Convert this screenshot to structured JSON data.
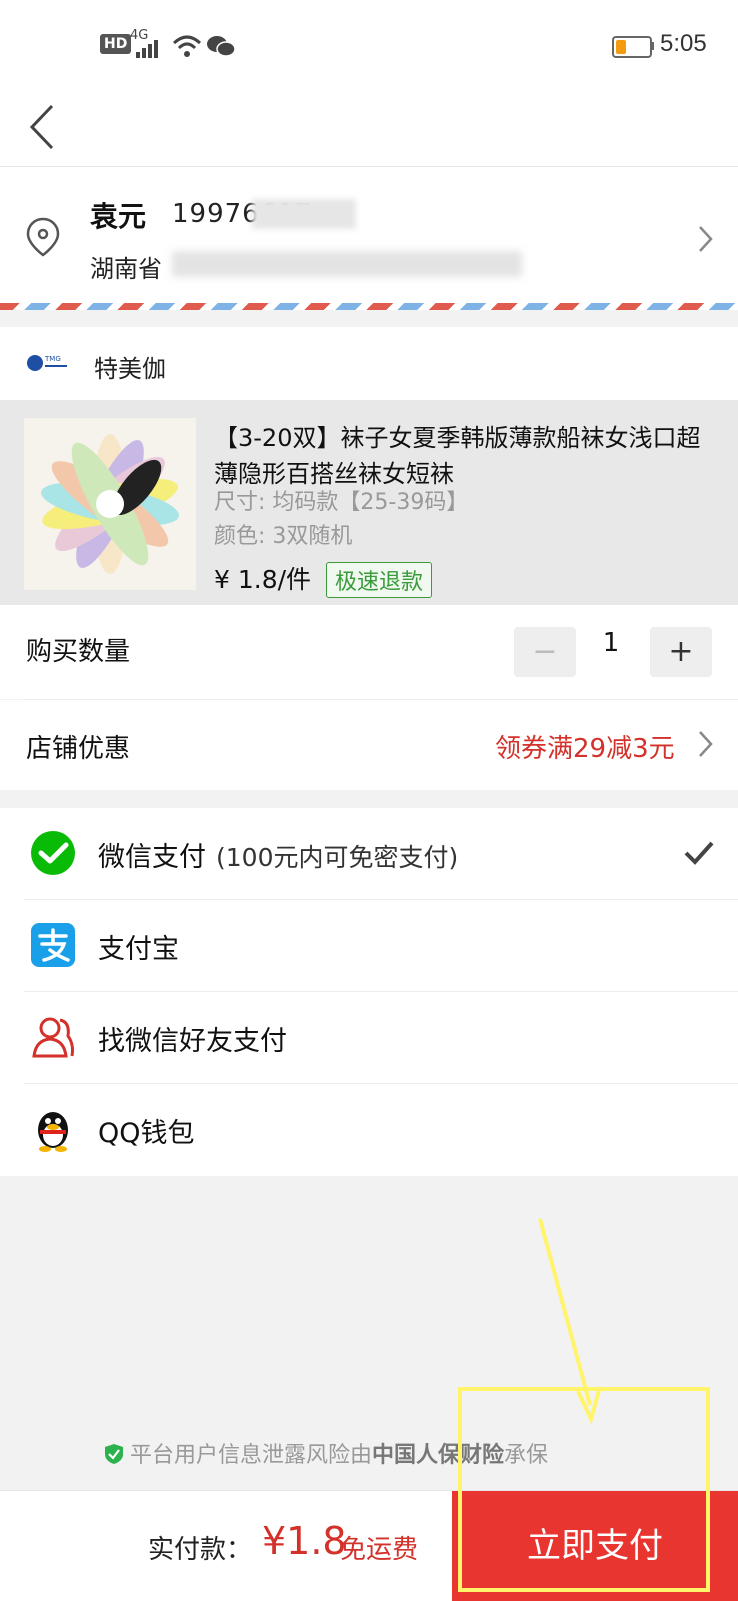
{
  "status_bar": {
    "hd": "HD",
    "network": "4G",
    "time": "5:05"
  },
  "nav": {
    "back_icon": "chevron-left-icon"
  },
  "address": {
    "name": "袁元",
    "phone": "19976697",
    "line": "湖南省"
  },
  "shop": {
    "name": "特美伽",
    "logo_text": "TMG"
  },
  "product": {
    "title": "【3-20双】袜子女夏季韩版薄款船袜女浅口超薄隐形百搭丝袜女短袜",
    "size": "尺寸: 均码款【25-39码】",
    "color": "颜色: 3双随机",
    "price": "¥ 1.8/件",
    "tag": "极速退款"
  },
  "quantity": {
    "label": "购买数量",
    "value": "1",
    "minus": "−",
    "plus": "+"
  },
  "coupon": {
    "label": "店铺优惠",
    "value": "领券满29减3元"
  },
  "payments": [
    {
      "icon": "wechat-pay-icon",
      "label": "微信支付",
      "note": "(100元内可免密支付)",
      "selected": true
    },
    {
      "icon": "alipay-icon",
      "label": "支付宝"
    },
    {
      "icon": "friend-pay-icon",
      "label": "找微信好友支付"
    },
    {
      "icon": "qq-wallet-icon",
      "label": "QQ钱包"
    }
  ],
  "insurance": {
    "prefix": "平台用户信息泄露风险由",
    "company": "中国人保财险",
    "suffix": "承保"
  },
  "bottom": {
    "pay_prefix": "实付款：",
    "total": "¥1.8",
    "shipping": "免运费",
    "button": "立即支付"
  },
  "colors": {
    "accent_red": "#e8352f",
    "price_red": "#d3312a",
    "wechat_green": "#09bb07",
    "alipay_blue": "#1aa0e8"
  }
}
